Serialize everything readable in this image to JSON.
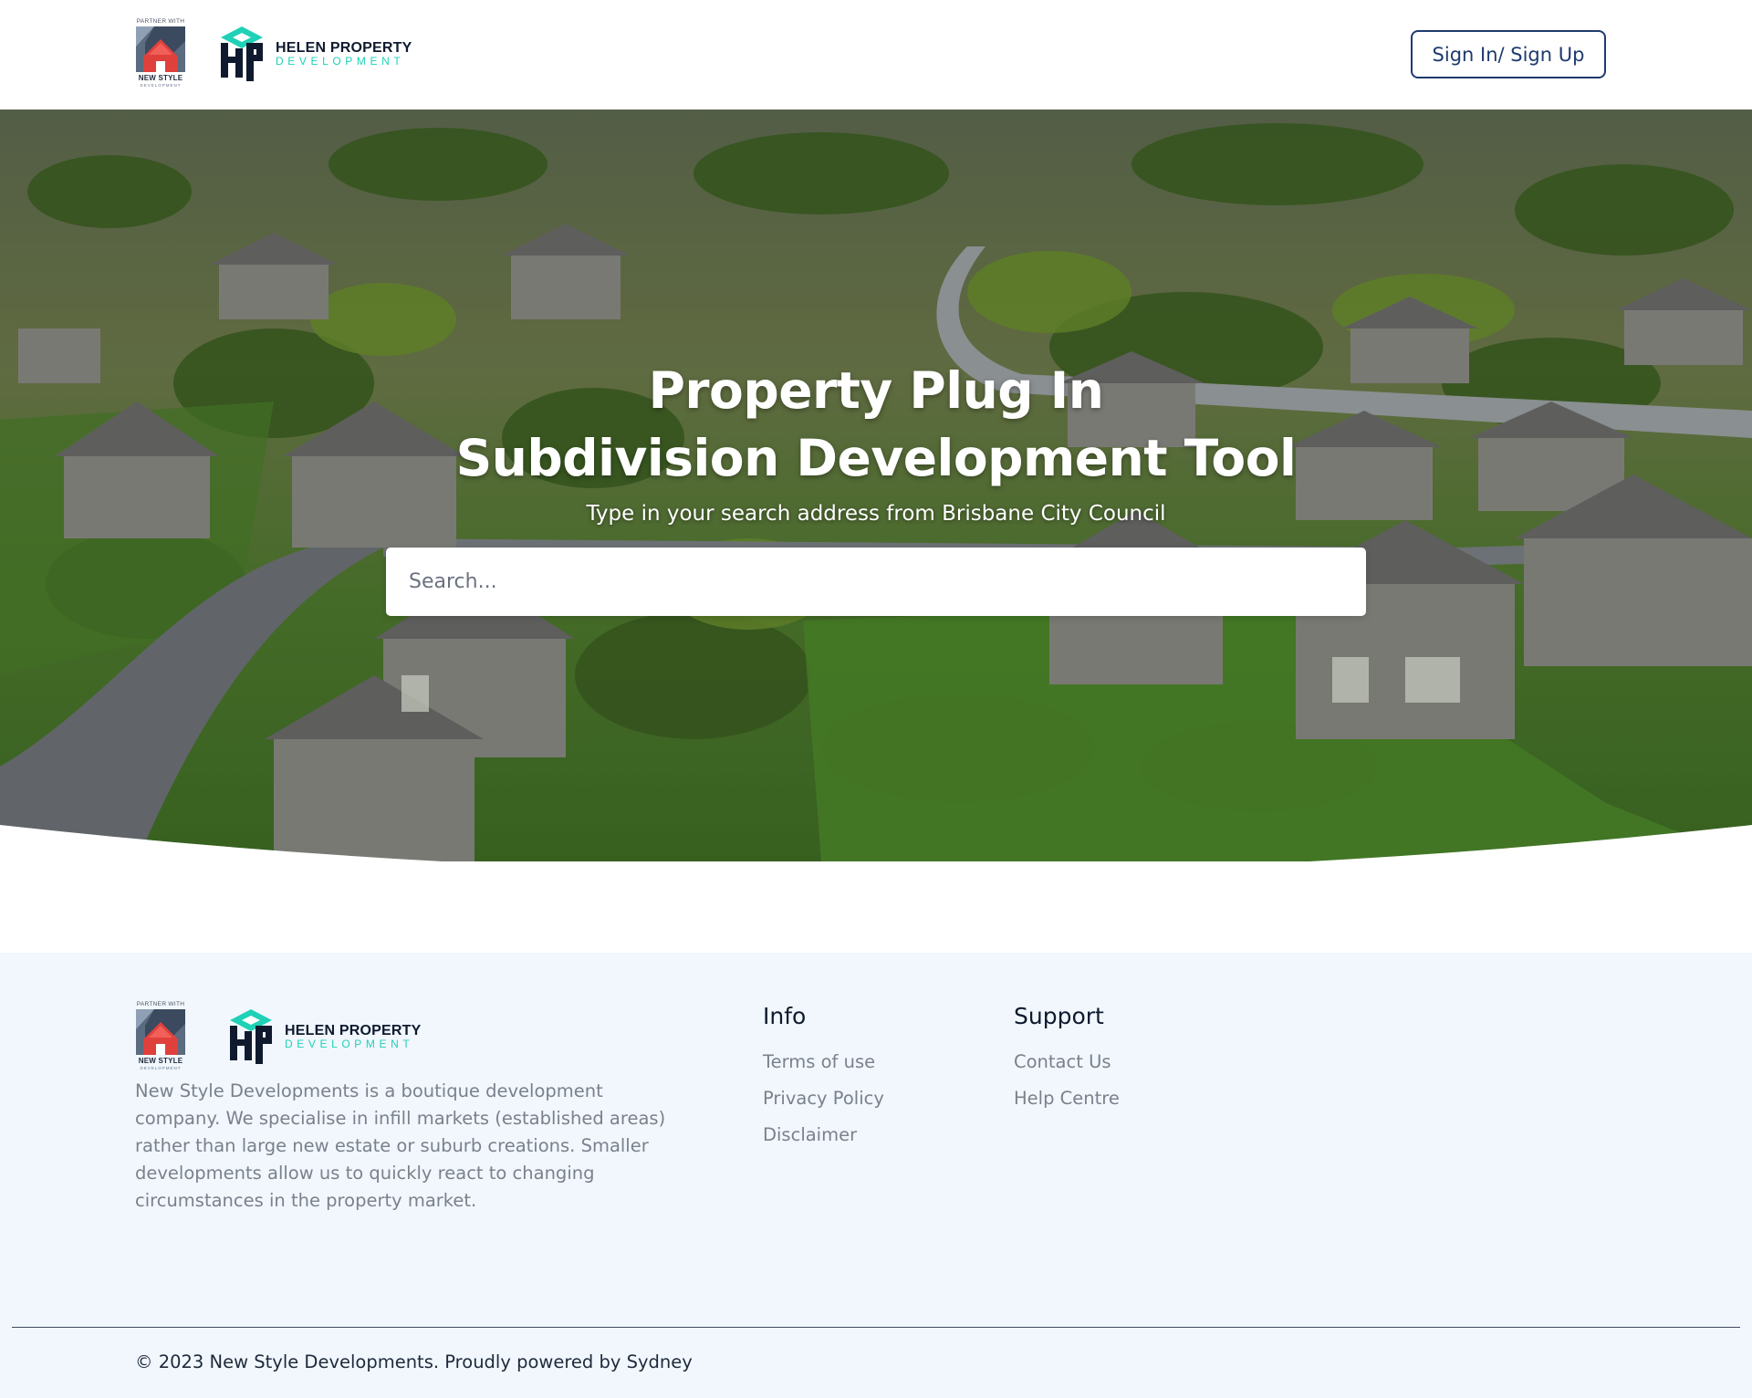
{
  "header": {
    "partner_logo": {
      "partner_text": "PARTNER WITH",
      "name": "NEW STYLE",
      "sub": "DEVELOPMENT"
    },
    "brand_logo": {
      "title": "HELEN PROPERTY",
      "subtitle": "DEVELOPMENT"
    },
    "signin_label": "Sign In/ Sign Up"
  },
  "hero": {
    "title_line1": "Property Plug In",
    "title_line2": "Subdivision Development Tool",
    "subtitle": "Type in your search address from Brisbane City Council",
    "search_placeholder": "Search..."
  },
  "footer": {
    "partner_logo": {
      "partner_text": "PARTNER WITH",
      "name": "NEW STYLE",
      "sub": "DEVELOPMENT"
    },
    "brand_logo": {
      "title": "HELEN PROPERTY",
      "subtitle": "DEVELOPMENT"
    },
    "description": "New Style Developments is a boutique development company. We specialise in infill markets (established areas) rather than large new estate or suburb creations. Smaller developments allow us to quickly react to changing circumstances in the property market.",
    "info": {
      "heading": "Info",
      "links": [
        "Terms of use",
        "Privacy Policy",
        "Disclaimer"
      ]
    },
    "support": {
      "heading": "Support",
      "links": [
        "Contact Us",
        "Help Centre"
      ]
    },
    "copyright": "© 2023 New Style Developments. Proudly powered by Sydney"
  },
  "colors": {
    "brand_navy": "#1e3a6e",
    "brand_teal": "#1fd1b6",
    "logo_red": "#e0403c",
    "footer_bg": "#f1f7fd"
  },
  "icons": {
    "partner_logo": "house-roof-logo-icon",
    "brand_logo": "hp-cube-logo-icon"
  }
}
